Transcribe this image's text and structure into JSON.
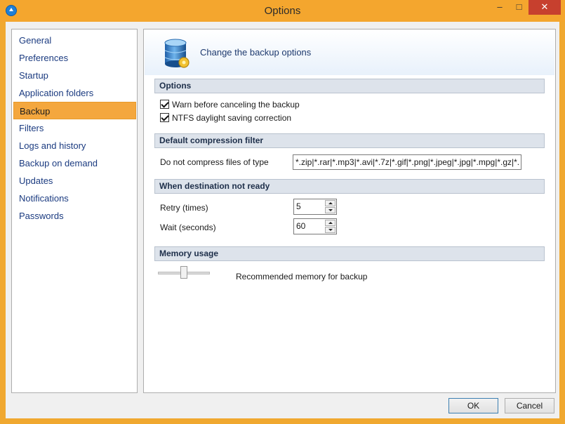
{
  "window": {
    "title": "Options",
    "controls": {
      "minimize": "–",
      "maximize": "□",
      "close": "✕"
    }
  },
  "sidebar": {
    "items": [
      {
        "label": "General"
      },
      {
        "label": "Preferences"
      },
      {
        "label": "Startup"
      },
      {
        "label": "Application folders"
      },
      {
        "label": "Backup",
        "selected": true
      },
      {
        "label": "Filters"
      },
      {
        "label": "Logs and history"
      },
      {
        "label": "Backup on demand"
      },
      {
        "label": "Updates"
      },
      {
        "label": "Notifications"
      },
      {
        "label": "Passwords"
      }
    ]
  },
  "panel": {
    "header_title": "Change the backup options",
    "icon": "database-gear-icon",
    "sections": {
      "options": {
        "title": "Options",
        "checks": [
          {
            "label": "Warn before canceling the backup",
            "checked": true
          },
          {
            "label": "NTFS daylight saving correction",
            "checked": true
          }
        ]
      },
      "compression": {
        "title": "Default compression filter",
        "label": "Do not compress files of type",
        "value": "*.zip|*.rar|*.mp3|*.avi|*.7z|*.gif|*.png|*.jpeg|*.jpg|*.mpg|*.gz|*."
      },
      "destination": {
        "title": "When destination not ready",
        "retry_label": "Retry (times)",
        "retry_value": "5",
        "wait_label": "Wait (seconds)",
        "wait_value": "60"
      },
      "memory": {
        "title": "Memory usage",
        "slider_label": "Recommended memory for backup"
      }
    }
  },
  "buttons": {
    "ok": "OK",
    "cancel": "Cancel"
  },
  "colors": {
    "accent": "#f4a73e",
    "titlebar": "#f4a62e",
    "close": "#c7402e"
  }
}
